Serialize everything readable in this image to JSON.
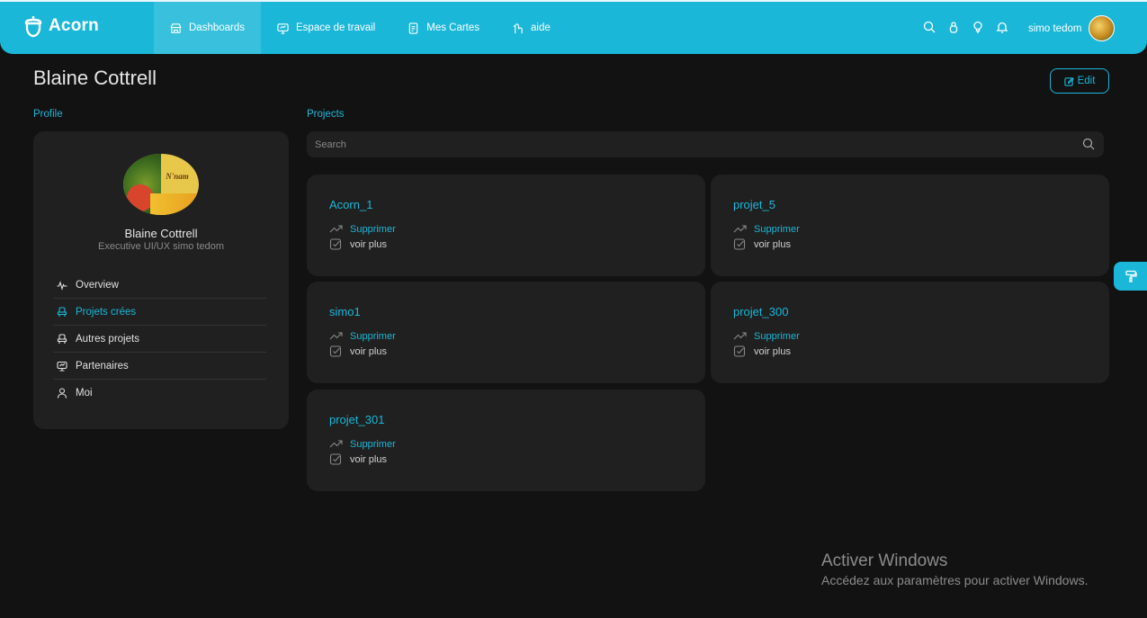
{
  "header": {
    "logo_text": "Acorn",
    "nav": [
      {
        "label": "Dashboards",
        "icon": "home-icon"
      },
      {
        "label": "Espace de travail",
        "icon": "monitor-icon"
      },
      {
        "label": "Mes Cartes",
        "icon": "document-icon"
      },
      {
        "label": "aide",
        "icon": "help-icon"
      }
    ],
    "icons": [
      "search-icon",
      "lock-icon",
      "lightbulb-icon",
      "bell-icon"
    ],
    "user_name": "simo tedom",
    "accent_color": "#1bb7d8"
  },
  "page": {
    "title": "Blaine Cottrell",
    "edit_label": "Edit"
  },
  "profile": {
    "section_label": "Profile",
    "avatar_text": "N'nam",
    "name": "Blaine Cottrell",
    "role": "Executive UI/UX simo tedom",
    "menu": [
      {
        "label": "Overview",
        "icon": "activity-icon",
        "active": false
      },
      {
        "label": "Projets crées",
        "icon": "seat-icon",
        "active": true
      },
      {
        "label": "Autres projets",
        "icon": "seat-icon",
        "active": false
      },
      {
        "label": "Partenaires",
        "icon": "presentation-icon",
        "active": false
      },
      {
        "label": "Moi",
        "icon": "user-icon",
        "active": false
      }
    ]
  },
  "projects": {
    "section_label": "Projects",
    "search_placeholder": "Search",
    "items": [
      {
        "title": "Acorn_1",
        "action1": "Supprimer",
        "action2": "voir plus"
      },
      {
        "title": "projet_5",
        "action1": "Supprimer",
        "action2": "voir plus"
      },
      {
        "title": "simo1",
        "action1": "Supprimer",
        "action2": "voir plus"
      },
      {
        "title": "projet_300",
        "action1": "Supprimer",
        "action2": "voir plus"
      },
      {
        "title": "projet_301",
        "action1": "Supprimer",
        "action2": "voir plus"
      }
    ]
  },
  "watermark": {
    "line1": "Activer Windows",
    "line2": "Accédez aux paramètres pour activer Windows."
  }
}
